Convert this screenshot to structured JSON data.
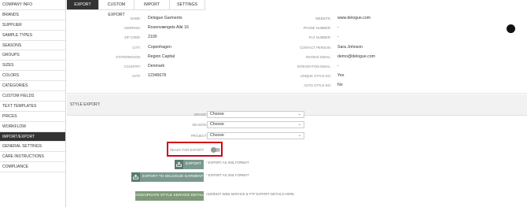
{
  "sidebar": {
    "items": [
      {
        "label": "COMPANY INFO"
      },
      {
        "label": "BRANDS"
      },
      {
        "label": "SUPPLIER"
      },
      {
        "label": "SAMPLE TYPES"
      },
      {
        "label": "SEASONS"
      },
      {
        "label": "GROUPS"
      },
      {
        "label": "SIZES"
      },
      {
        "label": "COLORS"
      },
      {
        "label": "CATEGORIES"
      },
      {
        "label": "CUSTOM FIELDS"
      },
      {
        "label": "TEXT TEMPLATES"
      },
      {
        "label": "PRICES"
      },
      {
        "label": "WORKFLOW"
      },
      {
        "label": "IMPORT/EXPORT"
      },
      {
        "label": "GENERAL SETTINGS"
      },
      {
        "label": "CARE INSTRUCTIONS"
      },
      {
        "label": "COMPLIANCE"
      }
    ],
    "active_index": 13
  },
  "tabs": [
    {
      "label": "EXPORT"
    },
    {
      "label": "CUSTOM EXPORT"
    },
    {
      "label": "IMPORT"
    },
    {
      "label": "SETTINGS"
    }
  ],
  "company": {
    "name_label": "NAME:",
    "name": "Delogue Garments",
    "address_label": "ADDRESS:",
    "address": "Rosenvængets Allé 16",
    "zip_label": "ZIP CODE:",
    "zip": "2100",
    "city_label": "CITY:",
    "city": "Copenhagen",
    "state_label": "STATE/REGION:",
    "state": "Region Capital",
    "country_label": "COUNTRY:",
    "country": "Denmark",
    "vat_label": "VAT#:",
    "vat": "12345678",
    "website_label": "WEBSITE:",
    "website": "www.delogue.com",
    "phone_label": "PHONE NUMBER:",
    "phone": "-",
    "fax_label": "FAX NUMBER:",
    "fax": "-",
    "contact_label": "CONTACT PERSON:",
    "contact": "Sara Johnson",
    "invoice_label": "INVOICE EMAIL:",
    "invoice": "demo@delogue.com",
    "integration_label": "INTEGRATION EMAIL:",
    "integration": "-",
    "unique_label": "UNIQUE STYLE NO:",
    "unique": "Yes",
    "auto_label": "AUTO STYLE NO:",
    "auto": "No"
  },
  "style_export": {
    "title": "STYLE EXPORT:",
    "brand_label": "BRAND:",
    "brand_value": "Choose",
    "season_label": "SEASON:",
    "season_value": "Choose",
    "project_label": "PROJECT:",
    "project_value": "Choose",
    "ready_label": "READY FOR EXPORT:",
    "ready_value": false,
    "export_button": "EXPORT",
    "export_note": "* EXPORT AS XML FORMAT",
    "export_delogue_button": "EXPORT TO DELOGUE GARMENTS",
    "export_delogue_note": "* EXPORT AS XML FORMAT",
    "service_button": "ADD/UPDATE STYLE SERVICE DETAILS",
    "service_note": "ADD/EDIT WEB SERVICE & FTP EXPORT DETAILS HERE."
  },
  "colors": {
    "active": "#333333",
    "highlight": "#d0021b",
    "button": "#7b9a8f"
  }
}
